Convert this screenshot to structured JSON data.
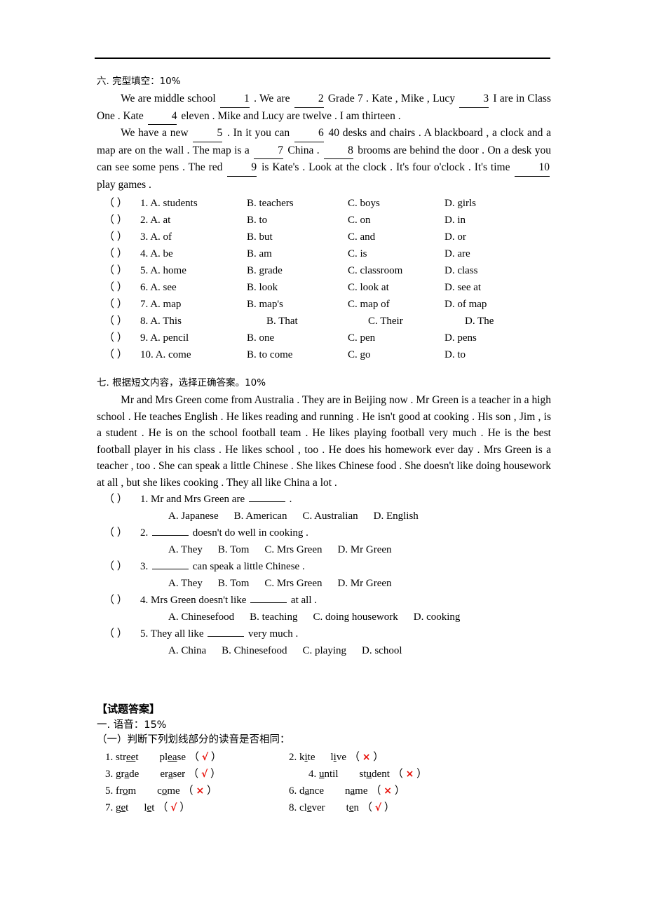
{
  "document": {
    "rule_present": true
  },
  "section6": {
    "heading": "六. 完型填空：10%",
    "paragraph1": {
      "t1": "We are middle school ",
      "b1": "1",
      "t2": " . We are ",
      "b2": "2",
      "t3": " Grade 7 . Kate , Mike , Lucy ",
      "b3": "3",
      "t4": " I are in Class One . Kate ",
      "b4": "4",
      "t5": " eleven . Mike and Lucy are twelve . I am thirteen ."
    },
    "paragraph2": {
      "t1": "We have a new ",
      "b5": "5",
      "t2": " . In it you can ",
      "b6": "6",
      "t3": " 40 desks and chairs . A blackboard , a clock and a map are on the wall . The map is a ",
      "b7": "7",
      "t4": " China . ",
      "b8": "8",
      "t5": " brooms are behind the door . On a desk you can see some pens . The red ",
      "b9": "9",
      "t6": " is Kate's . Look at the clock . It's four o'clock . It's time ",
      "b10": "10",
      "t7": " play games ."
    },
    "questions": [
      {
        "num": "1.",
        "a": "A. students",
        "b": "B. teachers",
        "c": "C. boys",
        "d": "D. girls"
      },
      {
        "num": "2.",
        "a": "A. at",
        "b": "B. to",
        "c": "C. on",
        "d": "D. in"
      },
      {
        "num": "3.",
        "a": "A. of",
        "b": "B. but",
        "c": "C. and",
        "d": "D. or"
      },
      {
        "num": "4.",
        "a": "A. be",
        "b": "B. am",
        "c": "C. is",
        "d": "D. are"
      },
      {
        "num": "5.",
        "a": "A. home",
        "b": "B. grade",
        "c": "C. classroom",
        "d": "D. class"
      },
      {
        "num": "6.",
        "a": "A. see",
        "b": "B. look",
        "c": "C. look at",
        "d": "D. see at"
      },
      {
        "num": "7.",
        "a": "A. map",
        "b": "B. map's",
        "c": "C. map of",
        "d": "D. of map"
      },
      {
        "num": "8.",
        "a": "A. This",
        "b": "B. That",
        "c": "C. Their",
        "d": "D. The"
      },
      {
        "num": "9.",
        "a": "A. pencil",
        "b": "B. one",
        "c": "C. pen",
        "d": "D. pens"
      },
      {
        "num": "10.",
        "a": "A. come",
        "b": "B. to come",
        "c": "C. go",
        "d": "D. to"
      }
    ],
    "paren": "（     ）"
  },
  "section7": {
    "heading": "七. 根据短文内容，选择正确答案。10%",
    "passage": "Mr and Mrs Green come from Australia . They are in Beijing now . Mr Green is a teacher in a high school . He teaches English . He likes reading and running . He isn't good at cooking . His son , Jim , is a student . He is on the school football team . He likes playing football very much . He is the best football player in his class . He likes school , too . He does his homework ever day . Mrs Green is a teacher , too . She can speak a little Chinese . She likes Chinese food . She doesn't like doing housework at all , but she likes cooking . They all like China a lot .",
    "paren": "（     ）",
    "questions": [
      {
        "num": "1.",
        "stem_before": "Mr and Mrs Green are ",
        "stem_after": " .",
        "options": [
          "A. Japanese",
          "B. American",
          "C. Australian",
          "D. English"
        ]
      },
      {
        "num": "2.",
        "stem_before": "",
        "stem_after": " doesn't do well in cooking .",
        "options": [
          "A. They",
          "B. Tom",
          "C. Mrs Green",
          "D. Mr Green"
        ]
      },
      {
        "num": "3.",
        "stem_before": "",
        "stem_after": " can speak a little Chinese .",
        "options": [
          "A. They",
          "B. Tom",
          "C. Mrs Green",
          "D. Mr Green"
        ]
      },
      {
        "num": "4.",
        "stem_before": "Mrs Green doesn't like ",
        "stem_after": " at all .",
        "options": [
          "A. Chinesefood",
          "B. teaching",
          "C. doing housework",
          "D. cooking"
        ]
      },
      {
        "num": "5.",
        "stem_before": "They all like ",
        "stem_after": " very much .",
        "options": [
          "A. China",
          "B. Chinesefood",
          "C. playing",
          "D. school"
        ]
      }
    ]
  },
  "answers": {
    "title": "【试题答案】",
    "section1": "一. 语音：15%",
    "part1": "（一）判断下列划线部分的读音是否相同：",
    "check_glyph": "√",
    "cross_glyph": "×",
    "mark_color": "#e8120b",
    "items": [
      {
        "num": "1.",
        "w1_pre": "str",
        "w1_u": "ee",
        "w1_post": "t",
        "w2_pre": "pl",
        "w2_u": "ea",
        "w2_post": "se",
        "mark": "√"
      },
      {
        "num": "2.",
        "w1_pre": "k",
        "w1_u": "i",
        "w1_post": "te",
        "w2_pre": "l",
        "w2_u": "i",
        "w2_post": "ve",
        "mark": "×"
      },
      {
        "num": "3.",
        "w1_pre": "gr",
        "w1_u": "a",
        "w1_post": "de",
        "w2_pre": "er",
        "w2_u": "a",
        "w2_post": "ser",
        "mark": "√"
      },
      {
        "num": "4.",
        "w1_pre": "",
        "w1_u": "u",
        "w1_post": "ntil",
        "w2_pre": "st",
        "w2_u": "u",
        "w2_post": "dent",
        "mark": "×"
      },
      {
        "num": "5.",
        "w1_pre": "fr",
        "w1_u": "o",
        "w1_post": "m",
        "w2_pre": "c",
        "w2_u": "o",
        "w2_post": "me",
        "mark": "×"
      },
      {
        "num": "6.",
        "w1_pre": "d",
        "w1_u": "a",
        "w1_post": "nce",
        "w2_pre": "n",
        "w2_u": "a",
        "w2_post": "me",
        "mark": "×"
      },
      {
        "num": "7.",
        "w1_pre": "g",
        "w1_u": "e",
        "w1_post": "t",
        "w2_pre": "l",
        "w2_u": "e",
        "w2_post": "t",
        "mark": "√"
      },
      {
        "num": "8.",
        "w1_pre": "cl",
        "w1_u": "e",
        "w1_post": "ver",
        "w2_pre": "t",
        "w2_u": "e",
        "w2_post": "n",
        "mark": "√"
      }
    ]
  }
}
